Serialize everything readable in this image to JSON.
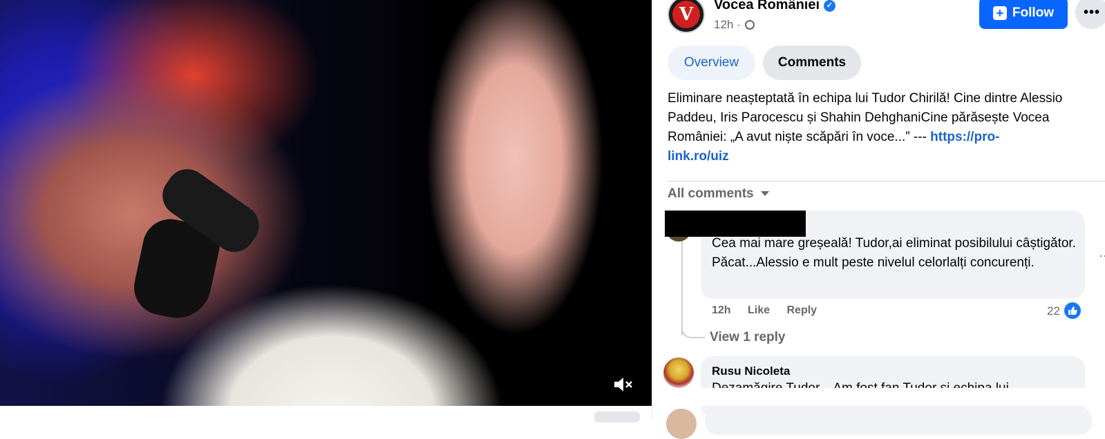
{
  "video": {
    "mute_icon": "mute-icon"
  },
  "post": {
    "page_name": "Vocea României",
    "avatar_letter": "V",
    "time": "12h ·",
    "follow_label": "Follow",
    "more_label": "•••",
    "tabs": [
      {
        "label": "Overview",
        "active": true
      },
      {
        "label": "Comments",
        "active": false
      }
    ],
    "text": "Eliminare neașteptată în echipa lui Tudor Chirilă! Cine dintre Alessio\nPaddeu, Iris Parocescu și Shahin DehghaniCine părăsește Vocea\nRomâniei: „A avut niște scăpări în voce...” --- ",
    "link": "https://pro-\nlink.ro/uiz"
  },
  "comments": {
    "filter_label": "All comments",
    "items": [
      {
        "author": "",
        "text": "Cea mai mare greșeală! Tudor,ai eliminat posibilului câștigător. Păcat...Alessio e mult peste nivelul celorlalți concurenți.",
        "time": "12h",
        "like_label": "Like",
        "reply_label": "Reply",
        "reactions": "22",
        "view_replies": "View 1 reply"
      },
      {
        "author": "Rusu Nicoleta",
        "text": "Dezamăgire Tudor... Am fost fan Tudor și echipa lui"
      }
    ]
  },
  "colors": {
    "accent": "#0866ff",
    "link": "#1b64c8",
    "muted": "#65676b",
    "bubble": "#f0f2f5"
  }
}
